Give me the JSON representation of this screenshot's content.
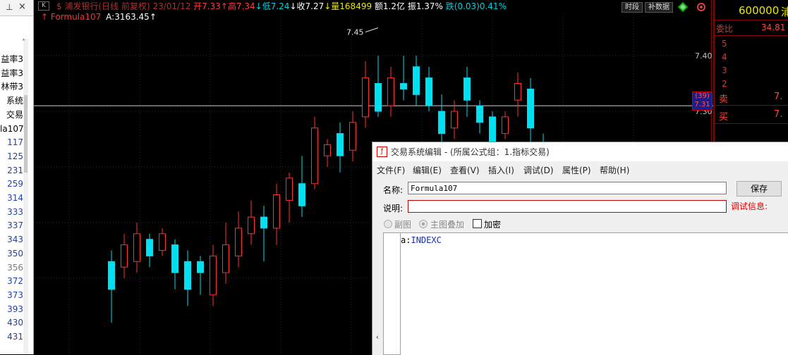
{
  "left_panel": {
    "pin_icon": "pin-icon",
    "close_icon": "close-icon",
    "items": [
      {
        "text": "益率3",
        "color": "#000000"
      },
      {
        "text": "益率3",
        "color": "#000000"
      },
      {
        "text": "林带3",
        "color": "#000000"
      },
      {
        "text": "系统",
        "color": "#000000"
      },
      {
        "text": "交易",
        "color": "#000000"
      },
      {
        "text": "la107",
        "color": "#000000"
      },
      {
        "text": "117",
        "color": "#1f3fb0"
      },
      {
        "text": "125",
        "color": "#1f3fb0"
      },
      {
        "text": "231",
        "color": "#1f3fb0"
      },
      {
        "text": "259",
        "color": "#1f3fb0"
      },
      {
        "text": "314",
        "color": "#1f3fb0"
      },
      {
        "text": "333",
        "color": "#1f3fb0"
      },
      {
        "text": "337",
        "color": "#1f3fb0"
      },
      {
        "text": "343",
        "color": "#1f3fb0"
      },
      {
        "text": "350",
        "color": "#1f3fb0"
      },
      {
        "text": "356",
        "color": "#7a7a7a"
      },
      {
        "text": "372",
        "color": "#1f3fb0"
      },
      {
        "text": "373",
        "color": "#1f3fb0"
      },
      {
        "text": "393",
        "color": "#1f3fb0"
      },
      {
        "text": "430",
        "color": "#1f3fb0"
      },
      {
        "text": "431",
        "color": "#1f3fb0"
      }
    ]
  },
  "chart": {
    "k_button": "K",
    "header": [
      {
        "text": "$ 浦发银行(日线 前复权) 23/01/12 ",
        "color": "#b03030"
      },
      {
        "text": "开7.33",
        "color": "#ff3c3c"
      },
      {
        "text": "↑高7.34",
        "color": "#ff3c3c"
      },
      {
        "text": "↓低7.24",
        "color": "#00d0e0"
      },
      {
        "text": "↓收7.27",
        "color": "#ffffff"
      },
      {
        "text": "↓量168499 ",
        "color": "#e8e800"
      },
      {
        "text": "额1.2亿 ",
        "color": "#ffffff"
      },
      {
        "text": "振1.37% ",
        "color": "#ffffff"
      },
      {
        "text": "跌(0.03)0.41%",
        "color": "#00d0e0"
      }
    ],
    "formula_icon": "formula-arrow-icon",
    "formula_name": "Formula107",
    "formula_value": "A:3163.45↑",
    "buttons": {
      "timeframe": "时段",
      "fill": "补数据"
    },
    "diamond_icon": "diamond-icon",
    "settings_icon": "settings-icon",
    "max_annotation": "7.45",
    "axis_labels": [
      "7.40",
      "7.30"
    ],
    "price_badge": {
      "top": "(39)",
      "bottom": "7.31"
    },
    "chart_data": {
      "type": "candlestick",
      "y_axis_ticks": [
        7.4,
        7.3
      ],
      "max_label": 7.45,
      "current_price": 7.31,
      "up_color": "#ff3030",
      "down_color": "#00e0f0",
      "candles": [
        {
          "open": 7.03,
          "close": 6.98,
          "high": 7.05,
          "low": 6.92
        },
        {
          "open": 7.02,
          "close": 7.06,
          "high": 7.08,
          "low": 7.0
        },
        {
          "open": 7.03,
          "close": 7.08,
          "high": 7.1,
          "low": 7.01
        },
        {
          "open": 7.07,
          "close": 7.04,
          "high": 7.08,
          "low": 7.02
        },
        {
          "open": 7.05,
          "close": 7.08,
          "high": 7.09,
          "low": 7.04
        },
        {
          "open": 7.06,
          "close": 7.01,
          "high": 7.07,
          "low": 6.98
        },
        {
          "open": 7.03,
          "close": 6.98,
          "high": 7.05,
          "low": 6.95
        },
        {
          "open": 7.03,
          "close": 7.01,
          "high": 7.04,
          "low": 6.97
        },
        {
          "open": 6.97,
          "close": 7.04,
          "high": 7.06,
          "low": 6.95
        },
        {
          "open": 7.01,
          "close": 7.06,
          "high": 7.1,
          "low": 6.99
        },
        {
          "open": 7.04,
          "close": 7.09,
          "high": 7.12,
          "low": 7.02
        },
        {
          "open": 7.08,
          "close": 7.11,
          "high": 7.14,
          "low": 7.06
        },
        {
          "open": 7.11,
          "close": 7.09,
          "high": 7.13,
          "low": 7.03
        },
        {
          "open": 7.09,
          "close": 7.15,
          "high": 7.17,
          "low": 7.06
        },
        {
          "open": 7.14,
          "close": 7.18,
          "high": 7.19,
          "low": 7.1
        },
        {
          "open": 7.17,
          "close": 7.13,
          "high": 7.22,
          "low": 7.11
        },
        {
          "open": 7.17,
          "close": 7.27,
          "high": 7.29,
          "low": 7.16
        },
        {
          "open": 7.22,
          "close": 7.24,
          "high": 7.25,
          "low": 7.2
        },
        {
          "open": 7.26,
          "close": 7.22,
          "high": 7.28,
          "low": 7.19
        },
        {
          "open": 7.23,
          "close": 7.28,
          "high": 7.3,
          "low": 7.21
        },
        {
          "open": 7.29,
          "close": 7.36,
          "high": 7.39,
          "low": 7.27
        },
        {
          "open": 7.35,
          "close": 7.3,
          "high": 7.4,
          "low": 7.29
        },
        {
          "open": 7.31,
          "close": 7.36,
          "high": 7.38,
          "low": 7.29
        },
        {
          "open": 7.35,
          "close": 7.34,
          "high": 7.4,
          "low": 7.32
        },
        {
          "open": 7.38,
          "close": 7.33,
          "high": 7.4,
          "low": 7.31
        },
        {
          "open": 7.36,
          "close": 7.31,
          "high": 7.38,
          "low": 7.3
        },
        {
          "open": 7.3,
          "close": 7.26,
          "high": 7.33,
          "low": 7.24
        },
        {
          "open": 7.27,
          "close": 7.3,
          "high": 7.32,
          "low": 7.25
        },
        {
          "open": 7.36,
          "close": 7.32,
          "high": 7.38,
          "low": 7.29
        },
        {
          "open": 7.31,
          "close": 7.28,
          "high": 7.32,
          "low": 7.26
        },
        {
          "open": 7.29,
          "close": 7.24,
          "high": 7.3,
          "low": 7.21
        },
        {
          "open": 7.26,
          "close": 7.29,
          "high": 7.3,
          "low": 7.25
        },
        {
          "open": 7.32,
          "close": 7.35,
          "high": 7.37,
          "low": 7.29
        },
        {
          "open": 7.34,
          "close": 7.27,
          "high": 7.36,
          "low": 7.24
        },
        {
          "open": 7.24,
          "close": 7.18,
          "high": 7.26,
          "low": 7.15
        },
        {
          "open": 7.23,
          "close": 7.2,
          "high": 7.24,
          "low": 7.17
        }
      ]
    }
  },
  "quote_panel": {
    "code": "600000",
    "name_fragment": "浦",
    "ratio_label": "委比",
    "ratio_value": "34.81",
    "ask_levels": [
      "5",
      "4",
      "3",
      "2"
    ],
    "sell_label": "卖",
    "sell_value": "7.",
    "buy_label": "买",
    "buy_value": "7."
  },
  "dialog": {
    "icon": "formula-editor-icon",
    "title": "交易系统编辑 - (所属公式组：1.指标交易)",
    "menu": [
      "文件(F)",
      "编辑(E)",
      "查看(V)",
      "插入(I)",
      "调试(D)",
      "属性(P)",
      "帮助(H)"
    ],
    "name_label": "名称:",
    "name_value": "Formula107",
    "desc_label": "说明:",
    "desc_value": "",
    "save_label": "保存",
    "debug_label": "调试信息:",
    "option_sub": "副图",
    "option_main": "主图叠加",
    "encrypt_label": "加密",
    "code_var": "a",
    "code_sep": ":",
    "code_func": "INDEXC"
  }
}
